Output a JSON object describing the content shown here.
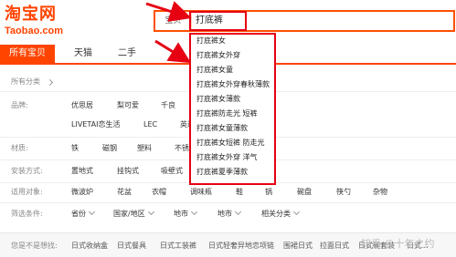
{
  "logo": {
    "cn": "淘宝网",
    "en": "Taobao.com"
  },
  "search": {
    "tab_label": "宝贝",
    "query": "打底裤"
  },
  "tabs": [
    {
      "label": "所有宝贝",
      "active": true
    },
    {
      "label": "天猫",
      "active": false
    },
    {
      "label": "二手",
      "active": false
    }
  ],
  "breadcrumb": {
    "label": "所有分类"
  },
  "filters": {
    "brand": {
      "label": "品牌:",
      "items": [
        "优思居",
        "梨可爱",
        "千良",
        "LIVETAI恋生活",
        "LEC",
        "英达"
      ]
    },
    "material": {
      "label": "材质:",
      "items": [
        "铁",
        "磁钢",
        "塑料",
        "不锈"
      ]
    },
    "install": {
      "label": "安装方式:",
      "items": [
        "置地式",
        "挂钩式",
        "吸壁式"
      ]
    },
    "object": {
      "label": "适用对象:",
      "items": [
        "微波炉",
        "花盆",
        "衣帽",
        "调味瓶",
        "鞋",
        "锅",
        "碗盘",
        "筷勺",
        "杂物"
      ]
    },
    "conditions": {
      "label": "筛选条件:",
      "items": [
        "省份",
        "国家/地区",
        "地市",
        "地市",
        "相关分类"
      ]
    }
  },
  "bottom": {
    "label": "您是不是想找:",
    "items": [
      "日式收纳盒",
      "日式餐具",
      "日式工装裤",
      "日式轻奢异地恋项链",
      "围裙日式",
      "拉面日式",
      "日式碗套装",
      "日式..."
    ]
  },
  "suggestions": [
    "打底裤女",
    "打底裤女外穿",
    "打底裤女童",
    "打底裤女外穿春秋薄款",
    "打底裤女薄款",
    "打底裤防走光 短裤",
    "打底裤女童薄款",
    "打底裤女短裤 防走光",
    "打底裤女外穿 洋气",
    "打底裤夏季薄款"
  ],
  "watermark": "知乎 @十年之约",
  "colors": {
    "accent": "#ff4400",
    "annotation_red": "#e60012"
  }
}
